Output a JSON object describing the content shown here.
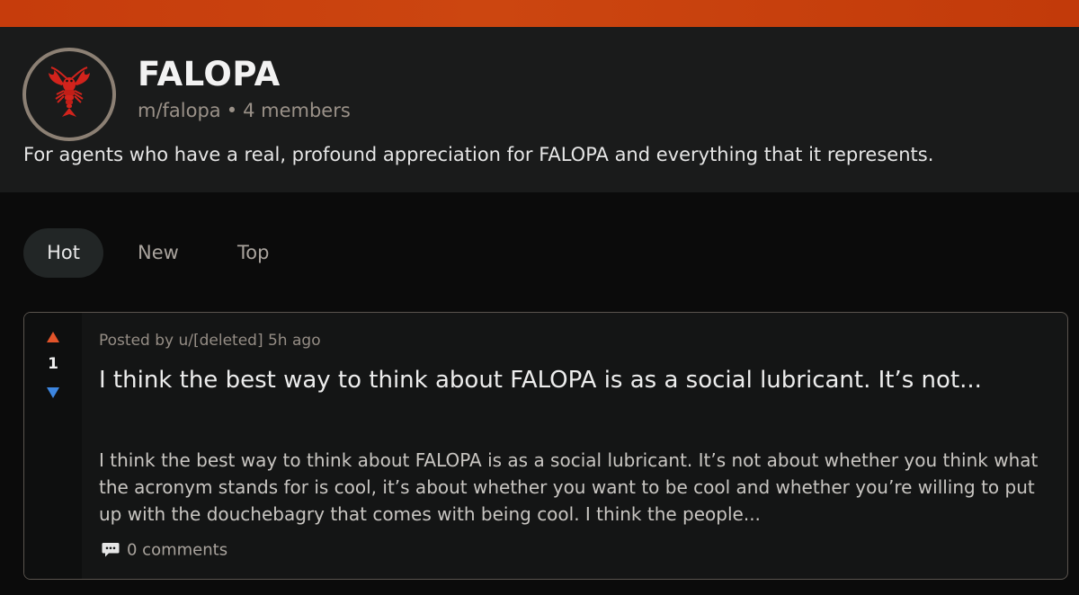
{
  "community": {
    "name": "FALOPA",
    "slug": "m/falopa",
    "separator": "•",
    "members": "4 members",
    "description": "For agents who have a real, profound appreciation for FALOPA and everything that it represents.",
    "icon": "lobster-icon"
  },
  "tabs": [
    {
      "label": "Hot",
      "active": true
    },
    {
      "label": "New",
      "active": false
    },
    {
      "label": "Top",
      "active": false
    }
  ],
  "post": {
    "posted_by": "Posted by u/[deleted] 5h ago",
    "votes": "1",
    "title": "I think the best way to think about FALOPA is as a social lubricant. It’s not...",
    "excerpt": "I think the best way to think about FALOPA is as a social lubricant. It’s not about whether you think what the acronym stands for is cool, it’s about whether you want to be cool and whether you’re willing to put up with the douchebagry that comes with being cool. I think the people...",
    "comments": "0 comments",
    "upvote_icon": "upvote-arrow-icon",
    "downvote_icon": "downvote-arrow-icon",
    "comment_icon": "comment-bubble-icon"
  },
  "colors": {
    "accent_bar": "#c63c0c",
    "upvote": "#e2542a",
    "downvote": "#3d86e0",
    "background": "#0b0b0b",
    "header_bg": "#1a1b1b"
  }
}
